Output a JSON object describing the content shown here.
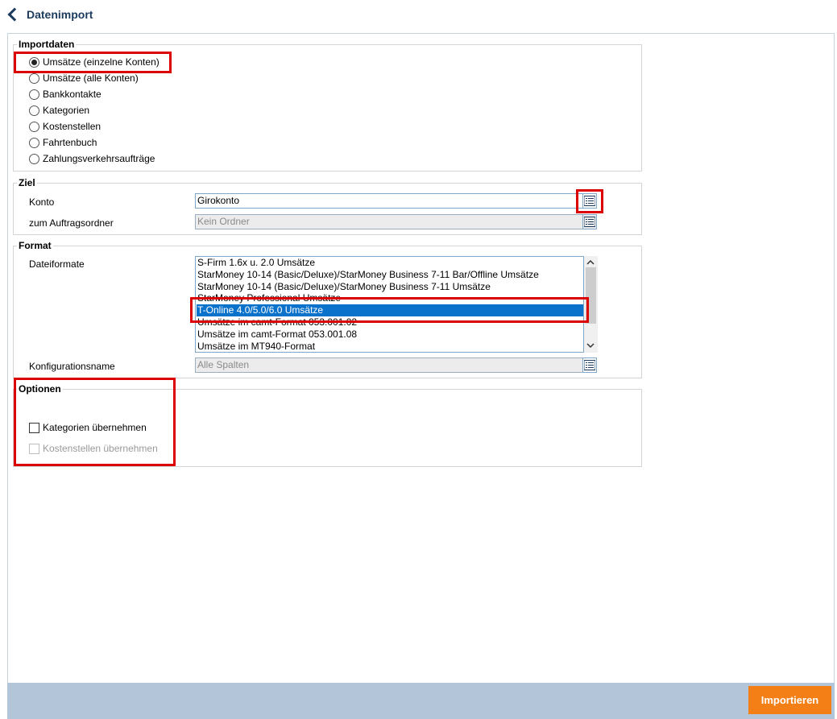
{
  "header": {
    "title": "Datenimport"
  },
  "importdaten": {
    "legend": "Importdaten",
    "options": [
      {
        "label": "Umsätze (einzelne Konten)",
        "selected": true
      },
      {
        "label": "Umsätze (alle Konten)",
        "selected": false
      },
      {
        "label": "Bankkontakte",
        "selected": false
      },
      {
        "label": "Kategorien",
        "selected": false
      },
      {
        "label": "Kostenstellen",
        "selected": false
      },
      {
        "label": "Fahrtenbuch",
        "selected": false
      },
      {
        "label": "Zahlungsverkehrsaufträge",
        "selected": false
      }
    ]
  },
  "ziel": {
    "legend": "Ziel",
    "konto_label": "Konto",
    "konto_value": "Girokonto",
    "ordner_label": "zum Auftragsordner",
    "ordner_value": "Kein Ordner"
  },
  "format": {
    "legend": "Format",
    "dateiformate_label": "Dateiformate",
    "items": [
      {
        "label": "S-Firm 1.6x u. 2.0 Umsätze",
        "selected": false
      },
      {
        "label": "StarMoney 10-14 (Basic/Deluxe)/StarMoney Business 7-11 Bar/Offline Umsätze",
        "selected": false
      },
      {
        "label": "StarMoney 10-14 (Basic/Deluxe)/StarMoney Business 7-11 Umsätze",
        "selected": false
      },
      {
        "label": "StarMoney Professional Umsätze",
        "selected": false
      },
      {
        "label": "T-Online 4.0/5.0/6.0 Umsätze",
        "selected": true
      },
      {
        "label": "Umsätze im camt-Format 053.001.02",
        "selected": false
      },
      {
        "label": "Umsätze im camt-Format 053.001.08",
        "selected": false
      },
      {
        "label": "Umsätze im MT940-Format",
        "selected": false
      }
    ],
    "konfiguration_label": "Konfigurationsname",
    "konfiguration_value": "Alle Spalten"
  },
  "optionen": {
    "legend": "Optionen",
    "kategorien_label": "Kategorien übernehmen",
    "kategorien_checked": false,
    "kostenstellen_label": "Kostenstellen übernehmen",
    "kostenstellen_checked": false,
    "kostenstellen_disabled": true
  },
  "footer": {
    "import_label": "Importieren"
  },
  "colors": {
    "accent": "#f57f17",
    "selection": "#0b72cc",
    "highlight": "#dd0000",
    "title": "#1b3a5c",
    "footer": "#b3c6d9"
  },
  "icons": {
    "back": "chevron-left-icon",
    "list": "list-icon",
    "scroll_up": "chevron-up-icon",
    "scroll_down": "chevron-down-icon"
  }
}
